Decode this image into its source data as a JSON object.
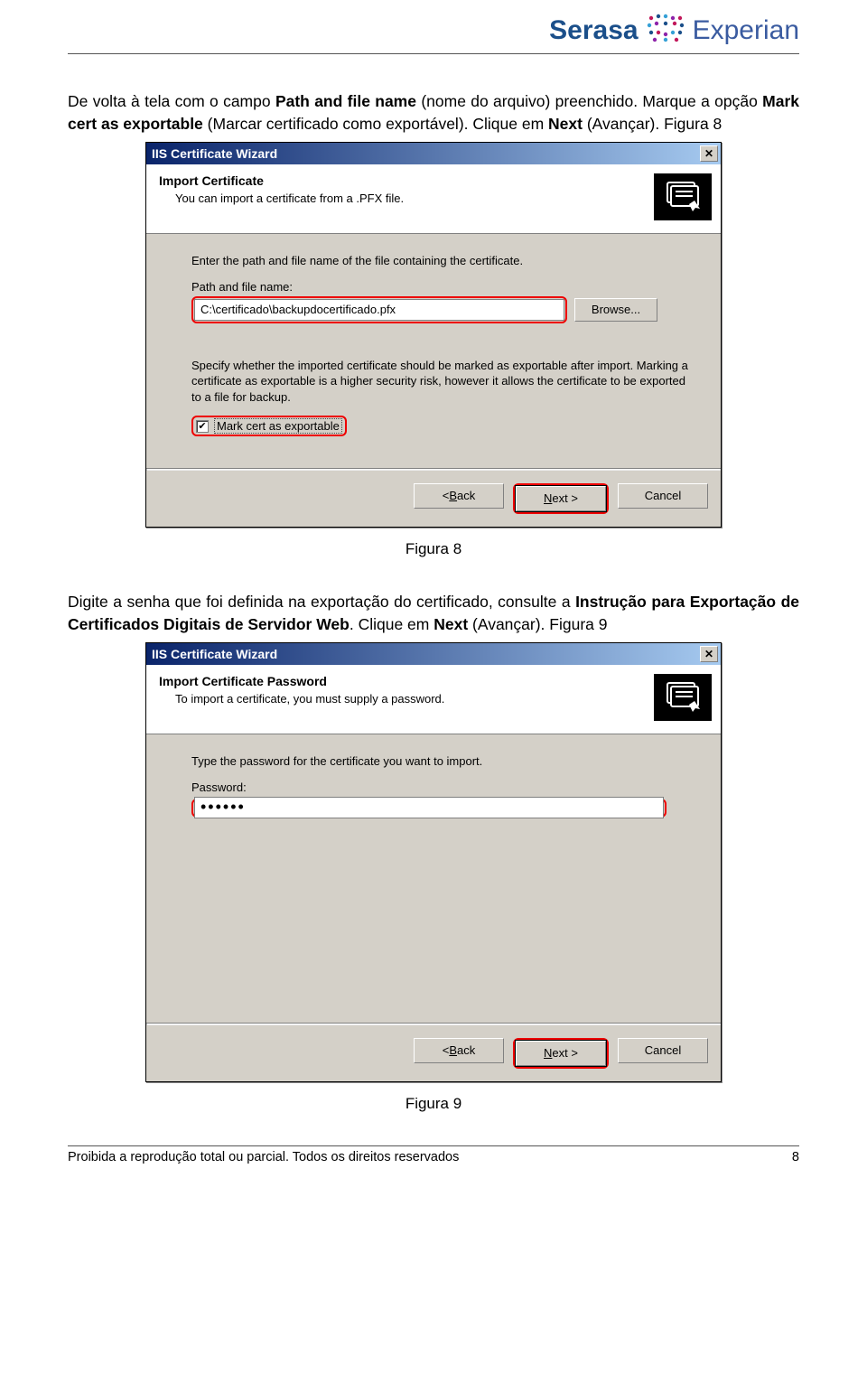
{
  "logo": {
    "serasa": "Serasa",
    "experian": "Experian"
  },
  "para1_a": "De volta à tela com o campo ",
  "para1_b": "Path and file name",
  "para1_c": " (nome do arquivo) preenchido. Marque a opção ",
  "para1_d": "Mark cert as exportable",
  "para1_e": " (Marcar certificado como exportável). Clique em ",
  "para1_f": "Next",
  "para1_g": " (Avançar). Figura 8",
  "caption8": "Figura 8",
  "para2_a": "Digite a senha que foi definida na exportação do certificado, consulte a ",
  "para2_b": "Instrução para Exportação de Certificados Digitais de Servidor Web",
  "para2_c": ". Clique em ",
  "para2_d": "Next",
  "para2_e": " (Avançar). Figura 9",
  "caption9": "Figura 9",
  "wizard1": {
    "title": "IIS Certificate Wizard",
    "banner_title": "Import Certificate",
    "banner_sub": "You can import a certificate from a .PFX file.",
    "instr": "Enter the path and file name of the file containing the certificate.",
    "path_label": "Path and file name:",
    "path_value": "C:\\certificado\\backupdocertificado.pfx",
    "browse": "Browse...",
    "note": "Specify whether the imported certificate should be marked as exportable after import. Marking a certificate as exportable is a higher security risk, however it allows the certificate to be exported to a file for backup.",
    "chk_label": "Mark cert as exportable",
    "back": "< Back",
    "next": "Next >",
    "cancel": "Cancel",
    "back_key": "B",
    "next_key": "N"
  },
  "wizard2": {
    "title": "IIS Certificate Wizard",
    "banner_title": "Import Certificate Password",
    "banner_sub": "To import a certificate, you must supply a password.",
    "instr": "Type the password for the certificate you want to import.",
    "pwd_label": "Password:",
    "pwd_value": "••••••",
    "back": "< Back",
    "next": "Next >",
    "cancel": "Cancel",
    "back_key": "B",
    "next_key": "N"
  },
  "footer_left": "Proibida a reprodução total ou parcial. Todos os direitos reservados",
  "footer_right": "8"
}
